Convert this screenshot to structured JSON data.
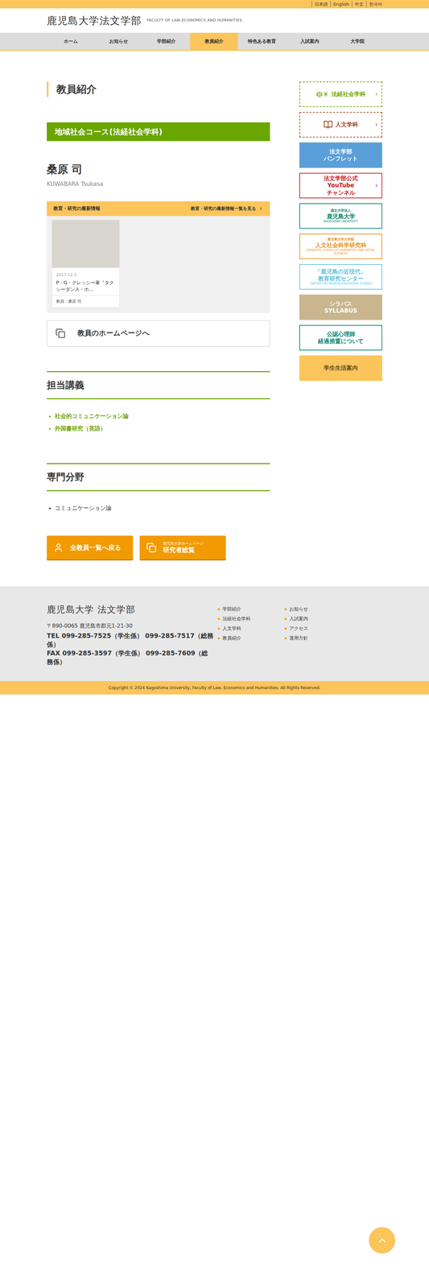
{
  "lang_links": [
    "日本語",
    "English",
    "中文",
    "한국어"
  ],
  "header": {
    "logo": "鹿児島大学法文学部",
    "subtitle": "FACULTY OF LAW,ECONOMICS AND HUMANITIES"
  },
  "nav": [
    {
      "label": "ホーム",
      "selected": false
    },
    {
      "label": "お知らせ",
      "selected": false
    },
    {
      "label": "学部紹介",
      "selected": false
    },
    {
      "label": "教員紹介",
      "selected": true
    },
    {
      "label": "特色ある教育",
      "selected": false
    },
    {
      "label": "入試案内",
      "selected": false
    },
    {
      "label": "大学院",
      "selected": false
    }
  ],
  "page_title": "教員紹介",
  "course": "地域社会コース(法経社会学科)",
  "teacher": {
    "name": "桑原 司",
    "romaji": "KUWABARA Tsukasa"
  },
  "news": {
    "title": "教育・研究の最新情報",
    "more_link": "教育・研究の最新情報一覧を見る",
    "items": [
      {
        "date": "2017.12.1",
        "title": "P・G・クレッシー著『タクシーダンス・ホ...",
        "author": "教員：桑原 司"
      }
    ]
  },
  "homepage_button": "教員のホームページへ",
  "sections": [
    {
      "heading": "担当講義",
      "kind": "link",
      "items": [
        "社会的コミュニケーション論",
        "外国書研究（英語）"
      ]
    },
    {
      "heading": "専門分野",
      "kind": "plain",
      "items": [
        "コミュニケーション論"
      ]
    }
  ],
  "bottom_buttons": [
    {
      "small": "",
      "label": "全教員一覧へ戻る"
    },
    {
      "small": "鹿児島大学ホームページ",
      "label": "研究者総覧"
    }
  ],
  "sidebar": [
    {
      "lines": [
        "法経社会学科"
      ],
      "kind": "dashed",
      "color": "#6aa600"
    },
    {
      "lines": [
        "人文学科"
      ],
      "kind": "dashed",
      "color": "#a0451c"
    },
    {
      "lines": [
        "法文学部",
        "パンフレット"
      ],
      "kind": "filled",
      "color": "#5b9fd8"
    },
    {
      "lines": [
        "法文学部公式",
        "YouTube",
        "チャンネル"
      ],
      "kind": "solid",
      "color": "#c8161d"
    },
    {
      "lines": [
        "国立大学法人",
        "鹿児島大学",
        "KAGOSHIMA UNIVERSITY"
      ],
      "kind": "solid",
      "color": "#00846b"
    },
    {
      "lines": [
        "鹿児島大学大学院",
        "人文社会科学研究科",
        "GRADUATE SCHOOL OF HUMANITIES AND SOCIAL SCIENCES"
      ],
      "kind": "solid",
      "color": "#e8901c"
    },
    {
      "lines": [
        "「鹿児島の近現代」",
        "教育研究センター",
        "CENTER FOR MODERN KAGOSHIMA STUDIES"
      ],
      "kind": "solid",
      "color": "#5bc2dc"
    },
    {
      "lines": [
        "シラバス",
        "SYLLABUS"
      ],
      "kind": "filled",
      "color": "#c9b68f"
    },
    {
      "lines": [
        "公認心理師",
        "経過措置について"
      ],
      "kind": "solid",
      "color": "#00846b"
    },
    {
      "lines": [
        "学生生活案内"
      ],
      "kind": "filled",
      "color": "#fbc55b"
    }
  ],
  "footer": {
    "name": "鹿児島大学 法文学部",
    "address": "〒890-0065 鹿児島市郡元1-21-30",
    "tel": "TEL 099-285-7525（学生係） 099-285-7517（総務係）",
    "fax": "FAX 099-285-3597（学生係） 099-285-7609（総務係）",
    "links": [
      [
        "学部紹介",
        "法経社会学科",
        "人文学科",
        "教員紹介"
      ],
      [
        "お知らせ",
        "入試案内",
        "アクセス",
        "運用方針"
      ]
    ],
    "copyright": "Copyright © 2024 Kagoshima University, Faculty of Law, Economics and Humanities. All Rights Reserved."
  }
}
